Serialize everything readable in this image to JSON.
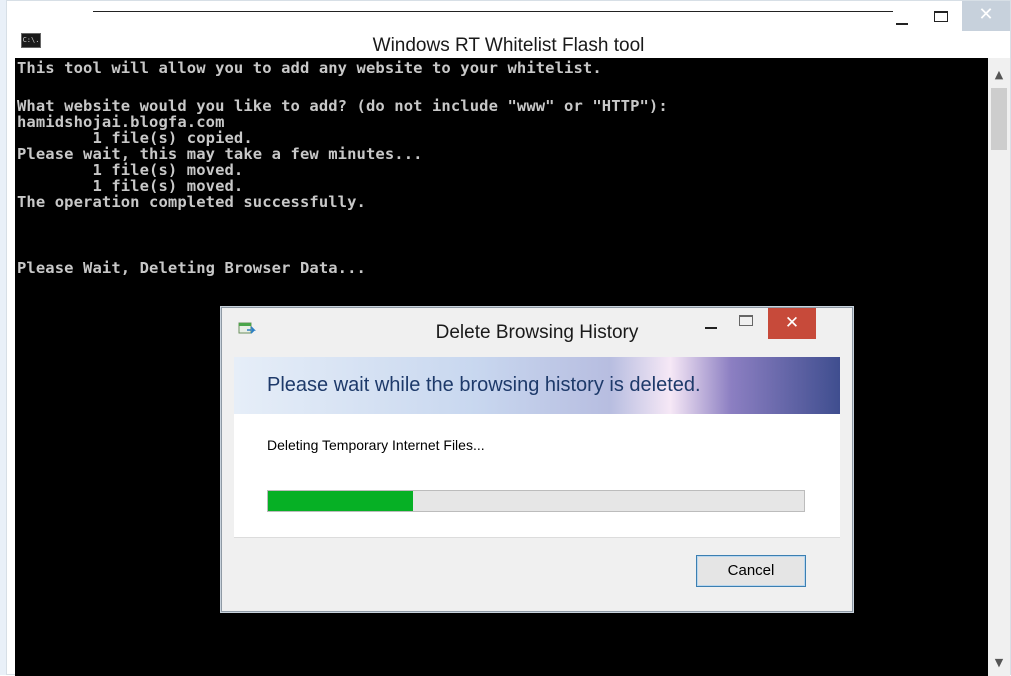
{
  "console": {
    "title": "Windows RT Whitelist Flash tool",
    "icon_label": "C:\\.",
    "icon": "console-icon",
    "lines": [
      "This tool will allow you to add any website to your whitelist.",
      "",
      "What website would you like to add? (do not include \"www\" or \"HTTP\"):",
      "hamidshojai.blogfa.com",
      "        1 file(s) copied.",
      "Please wait, this may take a few minutes...",
      "        1 file(s) moved.",
      "        1 file(s) moved.",
      "The operation completed successfully.",
      "",
      "",
      "Please Wait, Deleting Browser Data..."
    ],
    "close_glyph": "✕"
  },
  "dialog": {
    "title": "Delete Browsing History",
    "heading": "Please wait while the browsing history is deleted.",
    "status": "Deleting Temporary Internet Files...",
    "progress": 0.27,
    "cancel_label": "Cancel",
    "close_glyph": "✕"
  },
  "colors": {
    "console_bg": "#000000",
    "console_text": "#c8c8c8",
    "progress_fill": "#06b025",
    "close_red": "#c74a3a"
  }
}
